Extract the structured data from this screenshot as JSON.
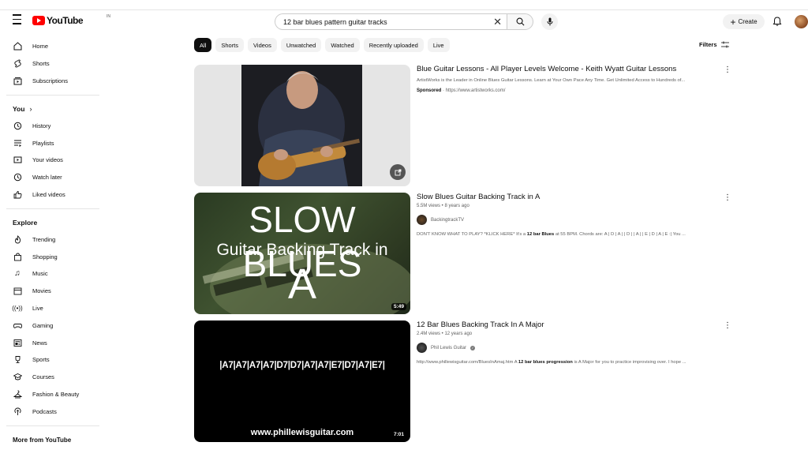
{
  "header": {
    "logo_text": "YouTube",
    "logo_country": "IN",
    "search_value": "12 bar blues pattern guitar tracks",
    "create_label": "Create"
  },
  "sidebar": {
    "main": [
      {
        "label": "Home",
        "icon": "home-icon"
      },
      {
        "label": "Shorts",
        "icon": "shorts-icon"
      },
      {
        "label": "Subscriptions",
        "icon": "subscriptions-icon"
      }
    ],
    "you_heading": "You",
    "you": [
      {
        "label": "History",
        "icon": "history-icon"
      },
      {
        "label": "Playlists",
        "icon": "playlists-icon"
      },
      {
        "label": "Your videos",
        "icon": "your-videos-icon"
      },
      {
        "label": "Watch later",
        "icon": "watch-later-icon"
      },
      {
        "label": "Liked videos",
        "icon": "liked-videos-icon"
      }
    ],
    "explore_heading": "Explore",
    "explore": [
      {
        "label": "Trending",
        "icon": "trending-icon"
      },
      {
        "label": "Shopping",
        "icon": "shopping-icon"
      },
      {
        "label": "Music",
        "icon": "music-icon"
      },
      {
        "label": "Movies",
        "icon": "movies-icon"
      },
      {
        "label": "Live",
        "icon": "live-icon"
      },
      {
        "label": "Gaming",
        "icon": "gaming-icon"
      },
      {
        "label": "News",
        "icon": "news-icon"
      },
      {
        "label": "Sports",
        "icon": "sports-icon"
      },
      {
        "label": "Courses",
        "icon": "courses-icon"
      },
      {
        "label": "Fashion & Beauty",
        "icon": "fashion-icon"
      },
      {
        "label": "Podcasts",
        "icon": "podcasts-icon"
      }
    ],
    "more_heading": "More from YouTube"
  },
  "chips": [
    "All",
    "Shorts",
    "Videos",
    "Unwatched",
    "Watched",
    "Recently uploaded",
    "Live"
  ],
  "filters_label": "Filters",
  "results": [
    {
      "title": "Blue Guitar Lessons - All Player Levels Welcome - Keith Wyatt Guitar Lessons",
      "description": "ArtistWorks is the Leader in Online Blues Guitar Lessons. Learn at Your Own Pace Any Time. Get Unlimited Access to Hundreds of...",
      "sponsored_label": "Sponsored",
      "sponsored_url": " · https://www.artistworks.com/"
    },
    {
      "title": "Slow Blues Guitar Backing Track in A",
      "meta": "5.5M views • 8 years ago",
      "channel": "BackingtrackTV",
      "description_pre": "DON'T KNOW WHAT TO PLAY? *KLICK HERE* It's a ",
      "description_bold": "12 bar Blues",
      "description_post": " at 55 BPM. Chords are: A | D | A | | D | | A | | E | D | A | E :| You ...",
      "thumb_line1": "SLOW BLUES",
      "thumb_line2": "Guitar Backing Track in",
      "thumb_line3": "A",
      "duration": "5:49"
    },
    {
      "title": "12 Bar Blues Backing Track In A Major",
      "meta": "2.4M views • 12 years ago",
      "channel": "Phil Lewis Guitar",
      "description_pre": "http://www.phillewisguitar.com/BluesInAmaj.htm A ",
      "description_bold": "12 bar blues progression",
      "description_post": " is A Major for you to practice improvising over. I hope ...",
      "thumb_chords": "|A7|A7|A7|A7|D7|D7|A7|A7|E7|D7|A7|E7|",
      "thumb_url": "www.phillewisguitar.com",
      "duration": "7:01"
    }
  ]
}
